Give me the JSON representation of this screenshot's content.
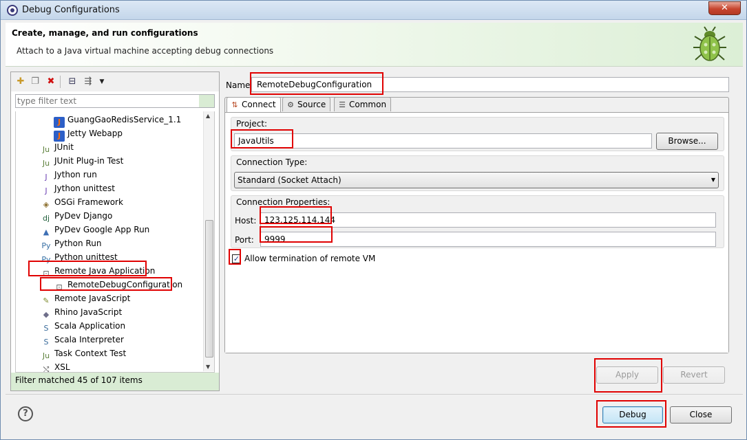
{
  "window": {
    "title": "Debug Configurations",
    "close_glyph": "✕"
  },
  "banner": {
    "title": "Create, manage, and run configurations",
    "description": "Attach to a Java virtual machine accepting debug connections"
  },
  "left": {
    "filter_placeholder": "type filter text",
    "items": [
      {
        "label": "GuangGaoRedisService_1.1",
        "icon": "jetty-config-icon",
        "glyph": "J",
        "color": "#2d5fc7"
      },
      {
        "label": "Jetty Webapp",
        "icon": "jetty-config-icon",
        "glyph": "J",
        "color": "#2d5fc7"
      },
      {
        "label": "JUnit",
        "icon": "junit-icon",
        "glyph": "Ju",
        "color": "#5b7f3a"
      },
      {
        "label": "JUnit Plug-in Test",
        "icon": "junit-plugin-icon",
        "glyph": "Ju",
        "color": "#5b7f3a"
      },
      {
        "label": "Jython run",
        "icon": "jython-run-icon",
        "glyph": "J",
        "color": "#6b3fb3"
      },
      {
        "label": "Jython unittest",
        "icon": "jython-unittest-icon",
        "glyph": "J",
        "color": "#6b3fb3"
      },
      {
        "label": "OSGi Framework",
        "icon": "osgi-icon",
        "glyph": "◈",
        "color": "#8a6d2b"
      },
      {
        "label": "PyDev Django",
        "icon": "django-icon",
        "glyph": "dj",
        "color": "#1f5e3a"
      },
      {
        "label": "PyDev Google App Run",
        "icon": "google-app-icon",
        "glyph": "▲",
        "color": "#3d6fb4"
      },
      {
        "label": "Python Run",
        "icon": "python-run-icon",
        "glyph": "Py",
        "color": "#366ea3"
      },
      {
        "label": "Python unittest",
        "icon": "python-unittest-icon",
        "glyph": "Py",
        "color": "#366ea3"
      },
      {
        "label": "Remote Java Application",
        "icon": "remote-java-icon",
        "glyph": "⊡",
        "color": "#555"
      },
      {
        "label": "RemoteDebugConfiguration",
        "icon": "remote-config-icon",
        "glyph": "⊡",
        "color": "#555"
      },
      {
        "label": "Remote JavaScript",
        "icon": "remote-javascript-icon",
        "glyph": "✎",
        "color": "#7c8a2b"
      },
      {
        "label": "Rhino JavaScript",
        "icon": "rhino-icon",
        "glyph": "◆",
        "color": "#6e6e8a"
      },
      {
        "label": "Scala Application",
        "icon": "scala-app-icon",
        "glyph": "S",
        "color": "#3a6b9b"
      },
      {
        "label": "Scala Interpreter",
        "icon": "scala-interpreter-icon",
        "glyph": "S",
        "color": "#3a6b9b"
      },
      {
        "label": "Task Context Test",
        "icon": "task-context-icon",
        "glyph": "Ju",
        "color": "#5b7f3a"
      },
      {
        "label": "XSL",
        "icon": "xsl-icon",
        "glyph": "⤭",
        "color": "#555"
      }
    ],
    "status": "Filter matched 45 of 107 items"
  },
  "right": {
    "name_label": "Name",
    "name_value": "RemoteDebugConfiguration",
    "tabs": [
      {
        "label": "Connect",
        "icon": "connect-tab-icon",
        "glyph": "⇅"
      },
      {
        "label": "Source",
        "icon": "source-tab-icon",
        "glyph": "⚙"
      },
      {
        "label": "Common",
        "icon": "common-tab-icon",
        "glyph": "☰"
      }
    ],
    "project_label": "Project:",
    "project_value": "JavaUtils",
    "browse_label": "Browse...",
    "connection_type_label": "Connection Type:",
    "connection_type_value": "Standard (Socket Attach)",
    "connection_props_label": "Connection Properties:",
    "host_label": "Host:",
    "host_value": "123.125.114.144",
    "port_label": "Port:",
    "port_value": "9999",
    "allow_termination_label": "Allow termination of remote VM",
    "allow_termination_checked": true,
    "apply_label": "Apply",
    "revert_label": "Revert"
  },
  "footer": {
    "debug_label": "Debug",
    "close_label": "Close",
    "help_glyph": "?"
  },
  "colors": {
    "highlight": "#e00000",
    "banner_green": "#dcefd6",
    "status_green": "#d9ecd4"
  }
}
